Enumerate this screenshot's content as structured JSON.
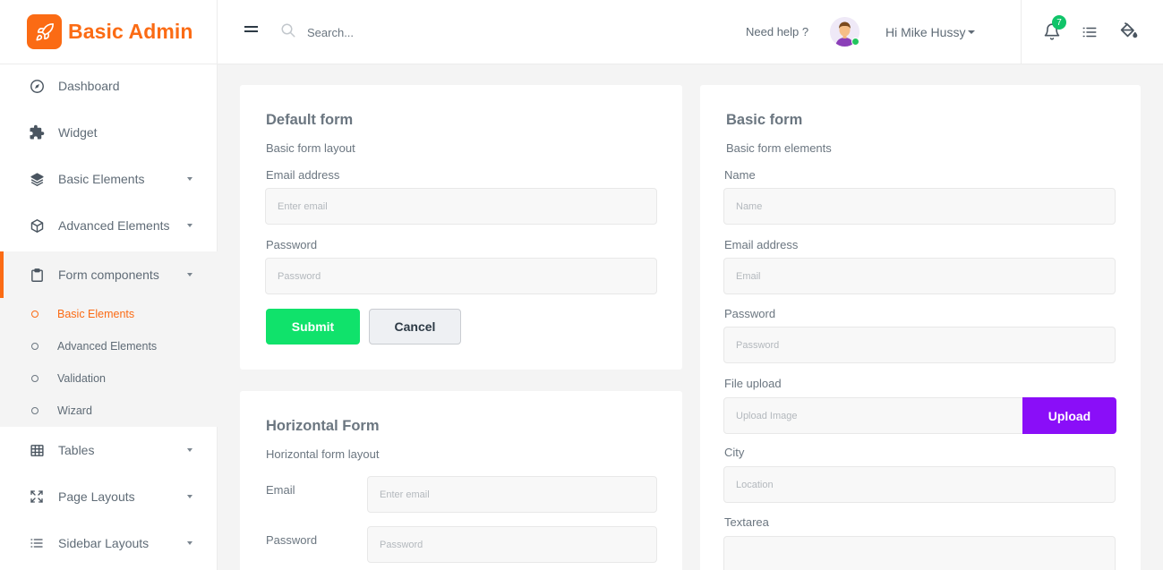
{
  "brand": {
    "name": "Basic Admin",
    "accent": "#fb6b14"
  },
  "sidebar": {
    "items": [
      {
        "label": "Dashboard",
        "icon": "compass-icon"
      },
      {
        "label": "Widget",
        "icon": "puzzle-icon"
      },
      {
        "label": "Basic Elements",
        "icon": "layers-icon"
      },
      {
        "label": "Advanced Elements",
        "icon": "cube-icon"
      },
      {
        "label": "Form components",
        "icon": "clipboard-icon"
      },
      {
        "label": "Tables",
        "icon": "table-icon"
      },
      {
        "label": "Page Layouts",
        "icon": "expand-icon"
      },
      {
        "label": "Sidebar Layouts",
        "icon": "list-icon"
      }
    ],
    "submenu": [
      {
        "label": "Basic Elements"
      },
      {
        "label": "Advanced Elements"
      },
      {
        "label": "Validation"
      },
      {
        "label": "Wizard"
      }
    ]
  },
  "header": {
    "search_placeholder": "Search...",
    "help": "Need help ?",
    "user": "Hi Mike Hussy",
    "notifications": "7",
    "badge_color": "#10c469"
  },
  "default_form": {
    "title": "Default form",
    "subtitle": "Basic form layout",
    "email_label": "Email address",
    "email_placeholder": "Enter email",
    "password_label": "Password",
    "password_placeholder": "Password",
    "submit": "Submit",
    "cancel": "Cancel",
    "submit_color": "#10e26b"
  },
  "horizontal_form": {
    "title": "Horizontal Form",
    "subtitle": "Horizontal form layout",
    "email_label": "Email",
    "email_placeholder": "Enter email",
    "password_label": "Password",
    "password_placeholder": "Password"
  },
  "basic_form": {
    "title": "Basic form",
    "subtitle": "Basic form elements",
    "name_label": "Name",
    "name_placeholder": "Name",
    "email_label": "Email address",
    "email_placeholder": "Email",
    "password_label": "Password",
    "password_placeholder": "Password",
    "file_label": "File upload",
    "file_placeholder": "Upload Image",
    "upload": "Upload",
    "city_label": "City",
    "city_placeholder": "Location",
    "textarea_label": "Textarea",
    "upload_color": "#8a0ef8"
  }
}
